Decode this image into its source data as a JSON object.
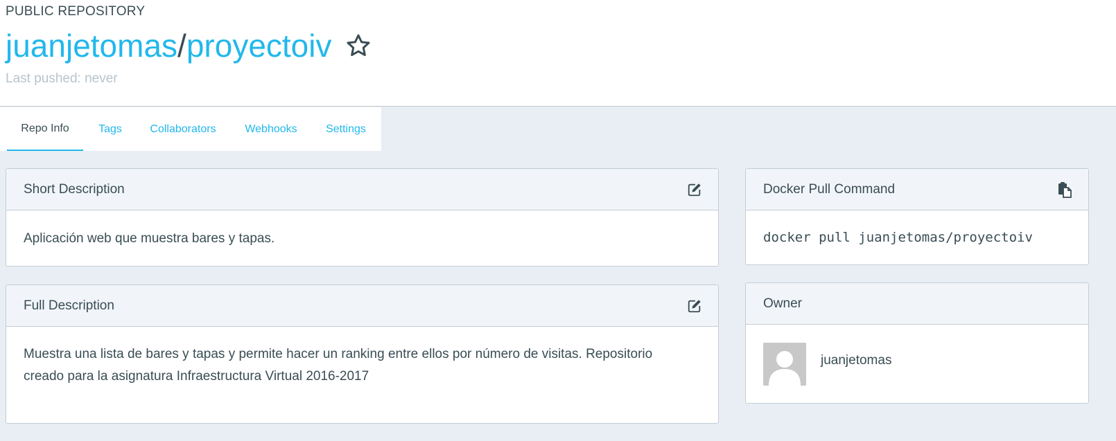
{
  "header": {
    "repo_type": "PUBLIC REPOSITORY",
    "namespace": "juanjetomas",
    "separator": "/",
    "repo_name": "proyectoiv",
    "star_icon": "star-outline-icon",
    "last_pushed": "Last pushed: never"
  },
  "tabs": [
    {
      "label": "Repo Info",
      "active": true
    },
    {
      "label": "Tags",
      "active": false
    },
    {
      "label": "Collaborators",
      "active": false
    },
    {
      "label": "Webhooks",
      "active": false
    },
    {
      "label": "Settings",
      "active": false
    }
  ],
  "short_description": {
    "title": "Short Description",
    "text": "Aplicación web que muestra bares y tapas.",
    "edit_icon": "edit-icon"
  },
  "full_description": {
    "title": "Full Description",
    "line1": "Muestra una lista de bares y tapas y permite hacer un ranking entre ellos por número de visitas. Repositorio",
    "line2": "creado para la asignatura Infraestructura Virtual 2016-2017",
    "edit_icon": "edit-icon"
  },
  "pull_command": {
    "title": "Docker Pull Command",
    "command": "docker pull juanjetomas/proyectoiv",
    "copy_icon": "clipboard-icon"
  },
  "owner": {
    "title": "Owner",
    "name": "juanjetomas",
    "avatar_icon": "default-avatar-icon"
  },
  "colors": {
    "accent": "#22b8eb",
    "text": "#394d54",
    "muted": "#b7c4cc",
    "page_bg": "#e8eef4",
    "panel_header_bg": "#f1f5f9"
  }
}
